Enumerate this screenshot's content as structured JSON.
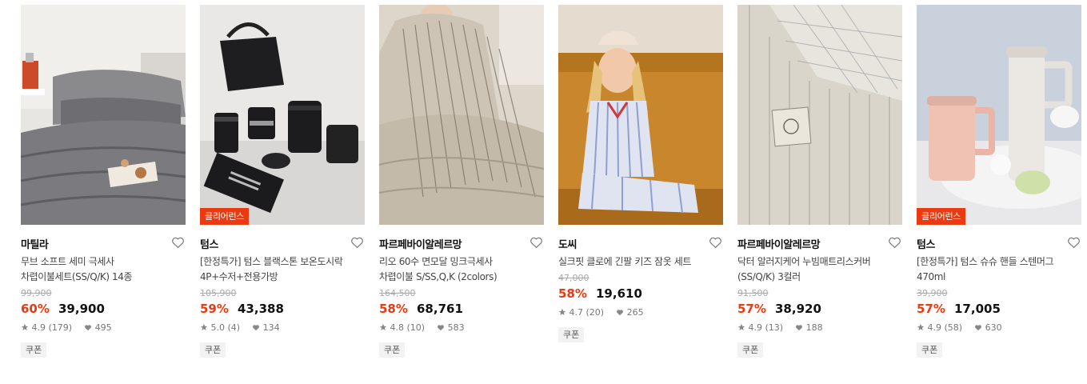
{
  "products": [
    {
      "brand": "마틸라",
      "title": "무브 소프트 세미 극세사\n차렵이불세트(SS/Q/K) 14종",
      "original_price": "99,900",
      "discount": "60%",
      "price": "39,900",
      "rating": "4.9",
      "reviews": "(179)",
      "likes": "495",
      "coupon": "쿠폰",
      "badge": "",
      "image": "grey-bedding"
    },
    {
      "brand": "텀스",
      "title": "[한정특가] 텀스 블랙스톤 보온도시락\n4P+수저+전용가방",
      "original_price": "105,900",
      "discount": "59%",
      "price": "43,388",
      "rating": "5.0",
      "reviews": "(4)",
      "likes": "134",
      "coupon": "쿠폰",
      "badge": "클리어런스",
      "image": "black-lunchbox"
    },
    {
      "brand": "파르페바이알레르망",
      "title": "리오 60수 면모달 밍크극세사\n차렵이불 S/SS,Q,K (2colors)",
      "original_price": "164,500",
      "discount": "58%",
      "price": "68,761",
      "rating": "4.8",
      "reviews": "(10)",
      "likes": "583",
      "coupon": "쿠폰",
      "badge": "",
      "image": "striped-duvet"
    },
    {
      "brand": "도씨",
      "title": "실크핏 클로에 긴팔 키즈 잠옷 세트",
      "original_price": "47,000",
      "discount": "58%",
      "price": "19,610",
      "rating": "4.7",
      "reviews": "(20)",
      "likes": "265",
      "coupon": "쿠폰",
      "badge": "",
      "image": "kids-pajama"
    },
    {
      "brand": "파르페바이알레르망",
      "title": "닥터 알러지케어 누빔매트리스커버\n(SS/Q/K) 3컬러",
      "original_price": "91,500",
      "discount": "57%",
      "price": "38,920",
      "rating": "4.9",
      "reviews": "(13)",
      "likes": "188",
      "coupon": "쿠폰",
      "badge": "",
      "image": "quilted-cover"
    },
    {
      "brand": "텀스",
      "title": "[한정특가] 텀스 슈슈 핸들 스텐머그\n470ml",
      "original_price": "39,900",
      "discount": "57%",
      "price": "17,005",
      "rating": "4.9",
      "reviews": "(58)",
      "likes": "630",
      "coupon": "쿠폰",
      "badge": "클리어런스",
      "image": "pastel-mugs"
    }
  ],
  "icons": {
    "wish": "heart-outline-icon",
    "rating": "star-icon",
    "likes": "heart-filled-icon"
  },
  "colors": {
    "discount": "#ea3a12",
    "badge": "#ea3a12"
  }
}
